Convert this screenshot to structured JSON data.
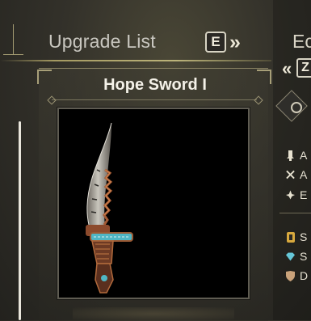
{
  "header": {
    "title": "Upgrade List",
    "key_hint": "E",
    "chevron": "»"
  },
  "right_panel": {
    "title_partial": "Ec",
    "chevron": "«",
    "key_hint": "Z",
    "stats": [
      {
        "icon": "attack-icon",
        "letter": "A"
      },
      {
        "icon": "affinity-icon",
        "letter": "A"
      },
      {
        "icon": "element-icon",
        "letter": "E"
      },
      {
        "icon": "slots-icon",
        "letter": "S"
      },
      {
        "icon": "skill-gem-icon",
        "letter": "S"
      },
      {
        "icon": "defense-shield-icon",
        "letter": "D"
      }
    ]
  },
  "item": {
    "name": "Hope Sword I",
    "image": "weapon-hope-sword"
  },
  "colors": {
    "accent_gold": "#bcb47a",
    "text": "#f4f1e8",
    "blade_teal": "#4fb6c4",
    "hilt_copper": "#b5643a"
  }
}
